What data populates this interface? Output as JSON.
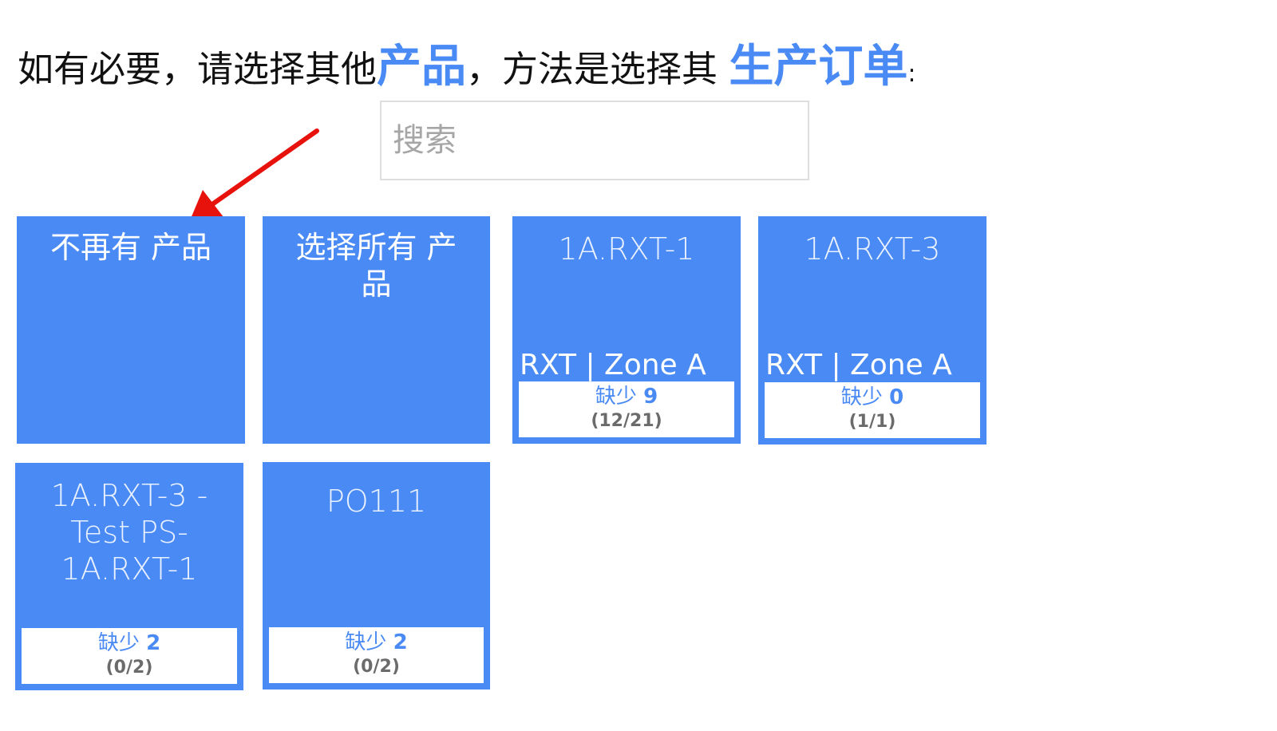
{
  "instruction": {
    "prefix": "如有必要，请选择其他",
    "product_word": "产品",
    "middle": "，方法是选择其 ",
    "order_word": "生产订单",
    "colon": ":"
  },
  "search": {
    "placeholder": "搜索"
  },
  "colors": {
    "accent": "#4a8af4",
    "arrow": "#e8120c",
    "status_text": "#6b6b6b"
  },
  "tiles": [
    {
      "title": "不再有 产品"
    },
    {
      "title": "选择所有 产品"
    },
    {
      "title": "1A.RXT-1",
      "location": "RXT | Zone A",
      "missing_label": "缺少",
      "missing_count": "9",
      "ratio": "(12/21)"
    },
    {
      "title": "1A.RXT-3",
      "location": "RXT | Zone A",
      "missing_label": "缺少",
      "missing_count": "0",
      "ratio": "(1/1)"
    },
    {
      "title": "1A.RXT-3 - Test PS-1A.RXT-1",
      "missing_label": "缺少",
      "missing_count": "2",
      "ratio": "(0/2)"
    },
    {
      "title": "PO111",
      "missing_label": "缺少",
      "missing_count": "2",
      "ratio": "(0/2)"
    }
  ]
}
